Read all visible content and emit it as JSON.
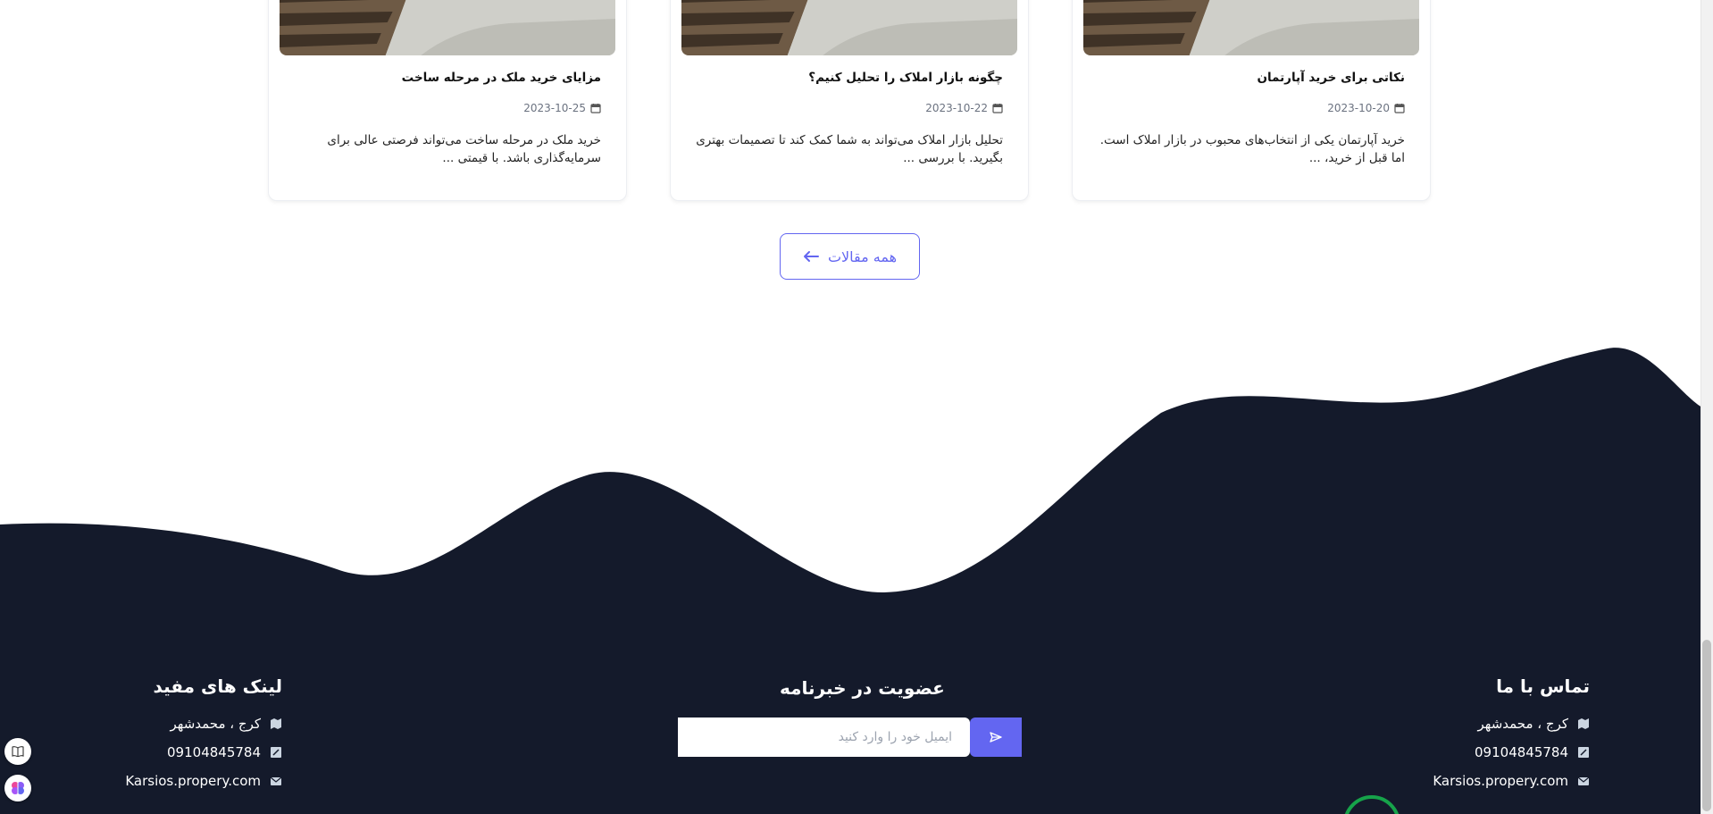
{
  "articles": [
    {
      "title": "نکاتی برای خرید آپارتمان",
      "date": "2023-10-20",
      "excerpt": "خرید آپارتمان یکی از انتخاب‌های محبوب در بازار املاک است. اما قبل از خرید، ..."
    },
    {
      "title": "چگونه بازار املاک را تحلیل کنیم؟",
      "date": "2023-10-22",
      "excerpt": "تحلیل بازار املاک می‌تواند به شما کمک کند تا تصمیمات بهتری بگیرید. با بررسی ..."
    },
    {
      "title": "مزایای خرید ملک در مرحله ساخت",
      "date": "2023-10-25",
      "excerpt": "خرید ملک در مرحله ساخت می‌تواند فرصتی عالی برای سرمایه‌گذاری باشد. با قیمتی ..."
    }
  ],
  "all_articles_label": "همه مقالات",
  "footer": {
    "contact": {
      "heading": "تماس با ما",
      "address": "کرج ، محمدشهر",
      "phone": "09104845784",
      "website": "Karsios.propery.com"
    },
    "newsletter": {
      "heading": "عضویت در خبرنامه",
      "placeholder": "ایمیل خود را وارد کنید"
    },
    "links": {
      "heading": "لینک های مفید",
      "address": "کرج ، محمدشهر",
      "phone": "09104845784",
      "website": "Karsios.propery.com"
    }
  },
  "colors": {
    "accent": "#6366f1",
    "footer_bg": "#141a2b",
    "ring": "#16a34a"
  },
  "icons": [
    "calendar-icon",
    "arrow-left-icon",
    "map-icon",
    "phone-icon",
    "mail-icon",
    "send-icon",
    "book-icon",
    "brain-icon"
  ]
}
